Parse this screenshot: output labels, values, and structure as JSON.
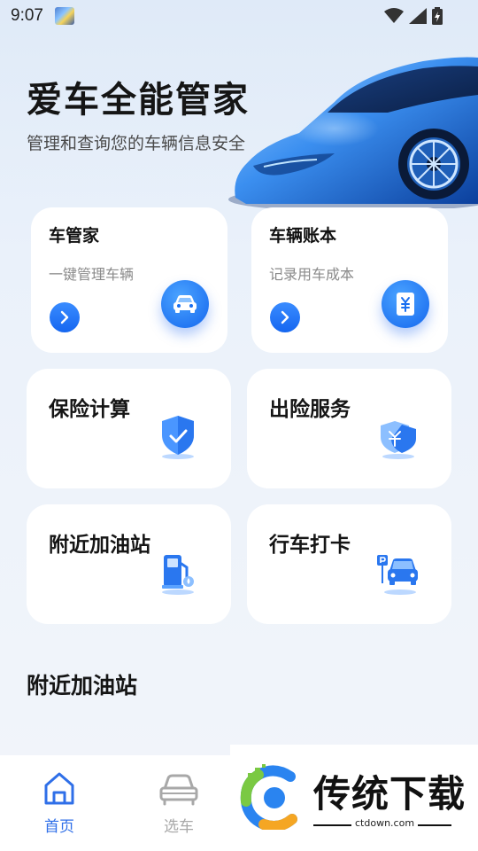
{
  "status_bar": {
    "time": "9:07",
    "icons": [
      "app-notification-icon",
      "wifi-icon",
      "signal-icon",
      "battery-charging-icon"
    ]
  },
  "hero": {
    "title": "爱车全能管家",
    "subtitle": "管理和查询您的车辆信息安全"
  },
  "top_cards": [
    {
      "title": "车管家",
      "subtitle": "一键管理车辆",
      "icon": "car-icon"
    },
    {
      "title": "车辆账本",
      "subtitle": "记录用车成本",
      "icon": "yuan-ledger-icon"
    }
  ],
  "grid_cards": [
    {
      "title": "保险计算",
      "icon": "shield-check-icon"
    },
    {
      "title": "出险服务",
      "icon": "shield-yuan-icon"
    },
    {
      "title": "附近加油站",
      "icon": "gas-station-icon"
    },
    {
      "title": "行车打卡",
      "icon": "parking-car-icon"
    }
  ],
  "section": {
    "title": "附近加油站"
  },
  "bottom_nav": [
    {
      "label": "首页",
      "icon": "home-icon",
      "active": true
    },
    {
      "label": "选车",
      "icon": "car-front-icon",
      "active": false
    }
  ],
  "watermark": {
    "text": "传统下载",
    "url": "ctdown.com"
  },
  "colors": {
    "accent": "#2f6fe8",
    "fab": "#1466ee",
    "inactive": "#a8a8a8",
    "background": "#eaf1fa"
  }
}
